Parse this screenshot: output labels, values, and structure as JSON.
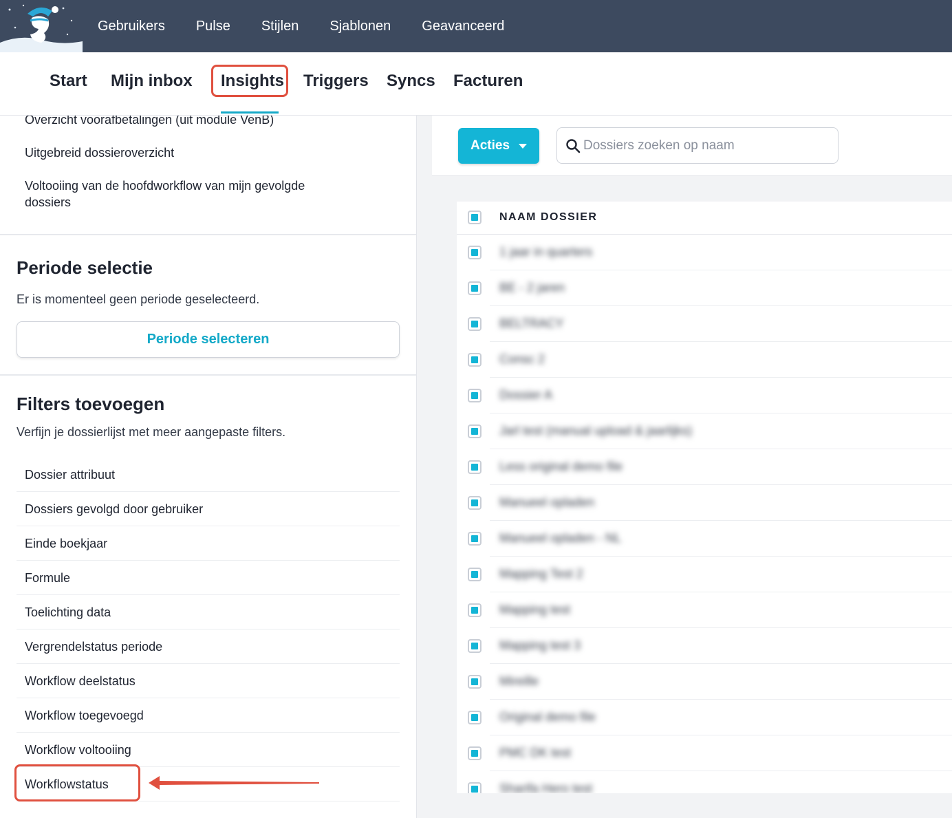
{
  "top_nav": {
    "items": [
      "Gebruikers",
      "Pulse",
      "Stijlen",
      "Sjablonen",
      "Geavanceerd"
    ]
  },
  "sub_nav": {
    "tabs": [
      "Start",
      "Mijn inbox",
      "Insights",
      "Triggers",
      "Syncs",
      "Facturen"
    ],
    "active": "Insights"
  },
  "sidebar": {
    "links": [
      "Overzicht voorafbetalingen (uit module VenB)",
      "Uitgebreid dossieroverzicht",
      "Voltooiing van de hoofdworkflow van mijn gevolgde dossiers"
    ],
    "period": {
      "title": "Periode selectie",
      "description": "Er is momenteel geen periode geselecteerd.",
      "button": "Periode selecteren"
    },
    "filters": {
      "title": "Filters toevoegen",
      "description": "Verfijn je dossierlijst met meer aangepaste filters.",
      "items": [
        "Dossier attribuut",
        "Dossiers gevolgd door gebruiker",
        "Einde boekjaar",
        "Formule",
        "Toelichting data",
        "Vergrendelstatus periode",
        "Workflow deelstatus",
        "Workflow toegevoegd",
        "Workflow voltooiing",
        "Workflowstatus"
      ]
    }
  },
  "main": {
    "acties_label": "Acties",
    "search_placeholder": "Dossiers zoeken op naam",
    "table": {
      "header": "NAAM DOSSIER",
      "rows": [
        "1 jaar in quarters",
        "BE - 2 jaren",
        "BELTRACY",
        "Consc 2",
        "Dossier A",
        "Jarl test (manual upload & jaarlijks)",
        "Less original demo file",
        "Manueel opladen",
        "Manueel opladen - NL",
        "Mapping Test 2",
        "Mapping test",
        "Mapping test 3",
        "Mireille",
        "Original demo file",
        "PMC DK test",
        "Sharifa Hero test"
      ]
    }
  },
  "colors": {
    "topbar": "#3d4a5f",
    "accent": "#14b5d6",
    "annotation": "#e0503f"
  }
}
